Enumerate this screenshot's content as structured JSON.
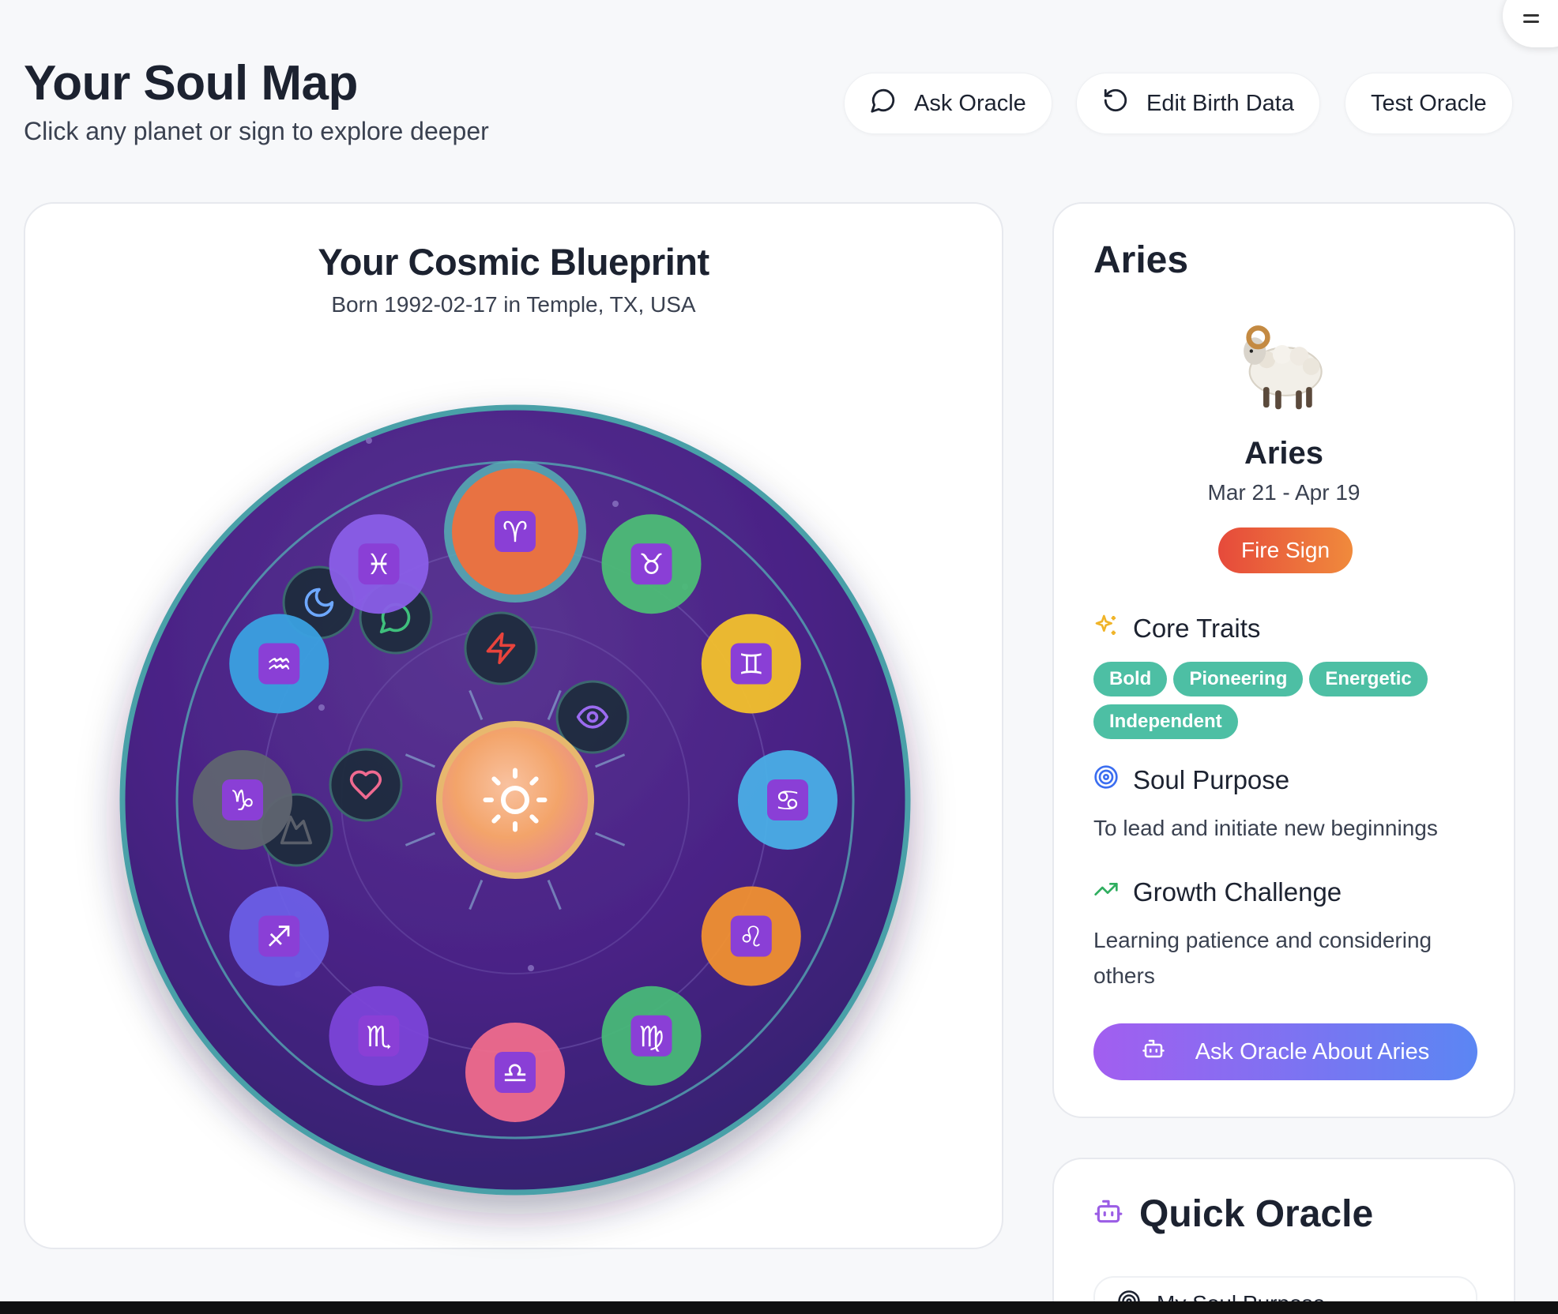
{
  "header": {
    "title": "Your Soul Map",
    "subtitle": "Click any planet or sign to explore deeper",
    "buttons": {
      "ask_oracle": "Ask Oracle",
      "edit_birth_data": "Edit Birth Data",
      "test_oracle": "Test Oracle"
    }
  },
  "chart": {
    "title": "Your Cosmic Blueprint",
    "subtitle": "Born 1992-02-17 in Temple, TX, USA",
    "signs": [
      {
        "key": "aries",
        "glyph": "♈",
        "color": "#f0703c"
      },
      {
        "key": "taurus",
        "glyph": "♉",
        "color": "#4cbc76"
      },
      {
        "key": "gemini",
        "glyph": "♊",
        "color": "#f2c02c"
      },
      {
        "key": "cancer",
        "glyph": "♋",
        "color": "#4aaee6"
      },
      {
        "key": "leo",
        "glyph": "♌",
        "color": "#f09030"
      },
      {
        "key": "virgo",
        "glyph": "♍",
        "color": "#48b878"
      },
      {
        "key": "libra",
        "glyph": "♎",
        "color": "#ef6b8c"
      },
      {
        "key": "scorpio",
        "glyph": "♏",
        "color": "#7b45d8"
      },
      {
        "key": "sagittarius",
        "glyph": "♐",
        "color": "#6b5fe6"
      },
      {
        "key": "capricorn",
        "glyph": "♑",
        "color": "#5f6470"
      },
      {
        "key": "aquarius",
        "glyph": "♒",
        "color": "#3aa0e0"
      },
      {
        "key": "pisces",
        "glyph": "♓",
        "color": "#8a5ee8"
      }
    ],
    "selected_sign": "aries",
    "planets": [
      {
        "key": "moon",
        "icon": "moon-icon",
        "color": "#6ea8ff"
      },
      {
        "key": "mercury",
        "icon": "message-circle-icon",
        "color": "#3fc07c"
      },
      {
        "key": "mars",
        "icon": "lightning-icon",
        "color": "#e8433c"
      },
      {
        "key": "neptune",
        "icon": "eye-icon",
        "color": "#9b6bf0"
      },
      {
        "key": "pluto",
        "icon": "target-icon",
        "color": "#4a6cf0"
      },
      {
        "key": "venus",
        "icon": "heart-icon",
        "color": "#f06a90"
      },
      {
        "key": "saturn",
        "icon": "mountain-icon",
        "color": "#5a5f6a"
      }
    ],
    "center": {
      "icon": "sun-icon"
    }
  },
  "sign_panel": {
    "heading": "Aries",
    "emoji": "ram-icon",
    "name": "Aries",
    "dates": "Mar 21 - Apr 19",
    "element_badge": "Fire Sign",
    "core_traits_title": "Core Traits",
    "traits": [
      "Bold",
      "Pioneering",
      "Energetic",
      "Independent"
    ],
    "soul_purpose_title": "Soul Purpose",
    "soul_purpose": "To lead and initiate new beginnings",
    "growth_title": "Growth Challenge",
    "growth": "Learning patience and considering others",
    "ask_button": "Ask Oracle About Aries"
  },
  "quick_oracle": {
    "title": "Quick Oracle",
    "items": [
      "My Soul Purpose"
    ]
  }
}
